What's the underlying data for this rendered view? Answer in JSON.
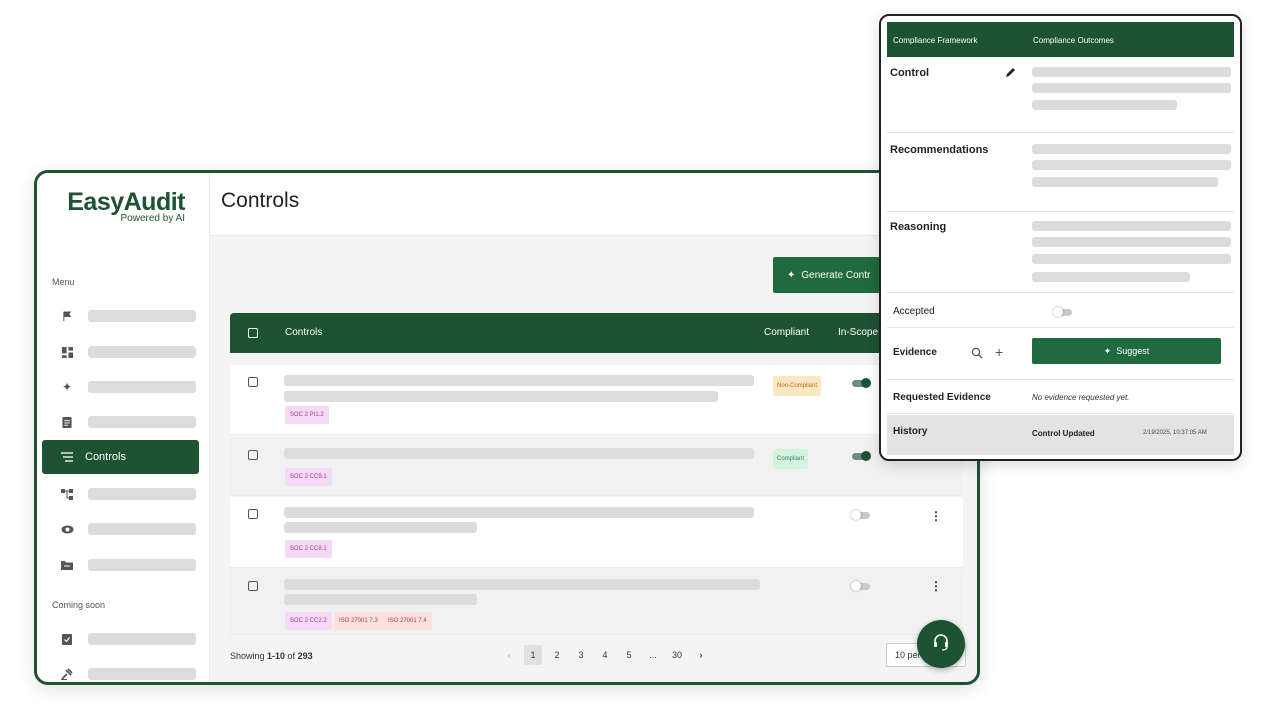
{
  "app": {
    "logo": "EasyAudit",
    "logo_sub": "Powered by AI",
    "menu_title": "Menu",
    "coming_soon_title": "Coming soon",
    "active_nav_label": "Controls"
  },
  "page": {
    "title": "Controls",
    "generate_button": "Generate Contr",
    "table_headers": {
      "controls": "Controls",
      "compliant": "Compliant",
      "in_scope": "In-Scope"
    }
  },
  "rows": [
    {
      "tags": [
        "SOC 2 PI1.2"
      ],
      "status": "Non-Compliant",
      "in_scope": true
    },
    {
      "tags": [
        "SOC 2 CC9.1"
      ],
      "status": "Compliant",
      "in_scope": true
    },
    {
      "tags": [
        "SOC 2 CC8.1"
      ],
      "status": "",
      "in_scope": false
    },
    {
      "tags": [
        "SOC 2 CC2.2",
        "ISO 27001 7.3",
        "ISO 27001 7.4"
      ],
      "status": "",
      "in_scope": false
    }
  ],
  "pagination": {
    "showing_prefix": "Showing ",
    "range": "1-10",
    "of": " of ",
    "total": "293",
    "pages": [
      "1",
      "2",
      "3",
      "4",
      "5",
      "...",
      "30"
    ],
    "prev": "‹",
    "next": "›",
    "per_page": "10 per"
  },
  "panel": {
    "tab_framework": "Compliance Framework",
    "tab_outcomes": "Compliance Outcomes",
    "control_label": "Control",
    "recommendations_label": "Recommendations",
    "reasoning_label": "Reasoning",
    "accepted_label": "Accepted",
    "evidence_label": "Evidence",
    "suggest_label": "Suggest",
    "requested_evidence_label": "Requested Evidence",
    "requested_evidence_value": "No evidence requested yet.",
    "history_label": "History",
    "history_event": "Control Updated",
    "history_time": "2/19/2025, 10:37:05 AM"
  },
  "colors": {
    "brand": "#1d5233",
    "button": "#1f6b3f"
  }
}
